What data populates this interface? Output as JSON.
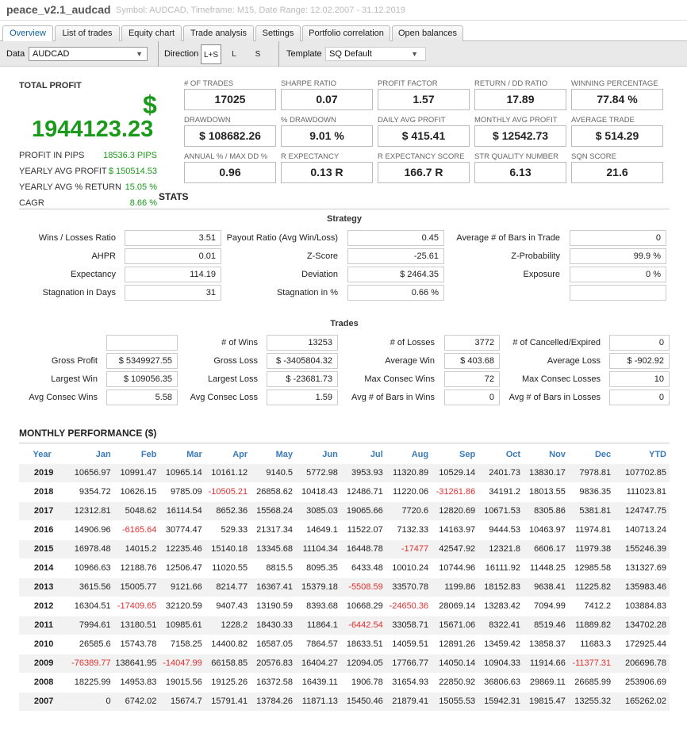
{
  "header": {
    "title": "peace_v2.1_audcad",
    "subtitle": "Symbol: AUDCAD, Timeframe: M15, Date Range: 12.02.2007 - 31.12.2019"
  },
  "tabs": [
    "Overview",
    "List of trades",
    "Equity chart",
    "Trade analysis",
    "Settings",
    "Portfolio correlation",
    "Open balances"
  ],
  "controls": {
    "data_label": "Data",
    "data_value": "AUDCAD",
    "direction_label": "Direction",
    "dir_options": [
      "L+S",
      "L",
      "S"
    ],
    "template_label": "Template",
    "template_value": "SQ Default"
  },
  "summary": {
    "total_profit_label": "TOTAL PROFIT",
    "dollar_sign": "$",
    "total_profit": "1944123.23",
    "rows": [
      [
        "PROFIT IN PIPS",
        "18536.3 PIPS"
      ],
      [
        "YEARLY AVG PROFIT",
        "$ 150514.53"
      ],
      [
        "YEARLY AVG % RETURN",
        "15.05 %"
      ],
      [
        "CAGR",
        "8.66 %"
      ]
    ]
  },
  "metrics": [
    [
      "# OF TRADES",
      "17025"
    ],
    [
      "SHARPE RATIO",
      "0.07"
    ],
    [
      "PROFIT FACTOR",
      "1.57"
    ],
    [
      "RETURN / DD RATIO",
      "17.89"
    ],
    [
      "WINNING PERCENTAGE",
      "77.84 %"
    ],
    [
      "DRAWDOWN",
      "$ 108682.26"
    ],
    [
      "% DRAWDOWN",
      "9.01 %"
    ],
    [
      "DAILY AVG PROFIT",
      "$ 415.41"
    ],
    [
      "MONTHLY AVG PROFIT",
      "$ 12542.73"
    ],
    [
      "AVERAGE TRADE",
      "$ 514.29"
    ],
    [
      "ANNUAL % / MAX DD %",
      "0.96"
    ],
    [
      "R EXPECTANCY",
      "0.13 R"
    ],
    [
      "R EXPECTANCY SCORE",
      "166.7 R"
    ],
    [
      "STR QUALITY NUMBER",
      "6.13"
    ],
    [
      "SQN SCORE",
      "21.6"
    ]
  ],
  "stats_title": "STATS",
  "strategy": {
    "title": "Strategy",
    "rows": [
      [
        [
          "Wins / Losses Ratio",
          "3.51"
        ],
        [
          "Payout Ratio (Avg Win/Loss)",
          "0.45"
        ],
        [
          "Average # of Bars in Trade",
          "0"
        ]
      ],
      [
        [
          "AHPR",
          "0.01"
        ],
        [
          "Z-Score",
          "-25.61"
        ],
        [
          "Z-Probability",
          "99.9 %"
        ]
      ],
      [
        [
          "Expectancy",
          "114.19"
        ],
        [
          "Deviation",
          "$ 2464.35"
        ],
        [
          "Exposure",
          "0 %"
        ]
      ],
      [
        [
          "Stagnation in Days",
          "31"
        ],
        [
          "Stagnation in %",
          "0.66 %"
        ],
        [
          "",
          ""
        ]
      ]
    ]
  },
  "trades": {
    "title": "Trades",
    "rows": [
      [
        [
          "",
          ""
        ],
        [
          "# of Wins",
          "13253"
        ],
        [
          "# of Losses",
          "3772"
        ],
        [
          "# of Cancelled/Expired",
          "0"
        ]
      ],
      [
        [
          "Gross Profit",
          "$ 5349927.55"
        ],
        [
          "Gross Loss",
          "$ -3405804.32"
        ],
        [
          "Average Win",
          "$ 403.68"
        ],
        [
          "Average Loss",
          "$ -902.92"
        ]
      ],
      [
        [
          "Largest Win",
          "$ 109056.35"
        ],
        [
          "Largest Loss",
          "$ -23681.73"
        ],
        [
          "Max Consec Wins",
          "72"
        ],
        [
          "Max Consec Losses",
          "10"
        ]
      ],
      [
        [
          "Avg Consec Wins",
          "5.58"
        ],
        [
          "Avg Consec Loss",
          "1.59"
        ],
        [
          "Avg # of Bars in Wins",
          "0"
        ],
        [
          "Avg # of Bars in Losses",
          "0"
        ]
      ]
    ]
  },
  "monthly": {
    "title": "MONTHLY PERFORMANCE ($)",
    "headers": [
      "Year",
      "Jan",
      "Feb",
      "Mar",
      "Apr",
      "May",
      "Jun",
      "Jul",
      "Aug",
      "Sep",
      "Oct",
      "Nov",
      "Dec",
      "YTD"
    ],
    "rows": [
      [
        "2019",
        "10656.97",
        "10991.47",
        "10965.14",
        "10161.12",
        "9140.5",
        "5772.98",
        "3953.93",
        "11320.89",
        "10529.14",
        "2401.73",
        "13830.17",
        "7978.81",
        "107702.85"
      ],
      [
        "2018",
        "9354.72",
        "10626.15",
        "9785.09",
        "-10505.21",
        "26858.62",
        "10418.43",
        "12486.71",
        "11220.06",
        "-31261.86",
        "34191.2",
        "18013.55",
        "9836.35",
        "111023.81"
      ],
      [
        "2017",
        "12312.81",
        "5048.62",
        "16114.54",
        "8652.36",
        "15568.24",
        "3085.03",
        "19065.66",
        "7720.6",
        "12820.69",
        "10671.53",
        "8305.86",
        "5381.81",
        "124747.75"
      ],
      [
        "2016",
        "14906.96",
        "-6165.64",
        "30774.47",
        "529.33",
        "21317.34",
        "14649.1",
        "11522.07",
        "7132.33",
        "14163.97",
        "9444.53",
        "10463.97",
        "11974.81",
        "140713.24"
      ],
      [
        "2015",
        "16978.48",
        "14015.2",
        "12235.46",
        "15140.18",
        "13345.68",
        "11104.34",
        "16448.78",
        "-17477",
        "42547.92",
        "12321.8",
        "6606.17",
        "11979.38",
        "155246.39"
      ],
      [
        "2014",
        "10966.63",
        "12188.76",
        "12506.47",
        "11020.55",
        "8815.5",
        "8095.35",
        "6433.48",
        "10010.24",
        "10744.96",
        "16111.92",
        "11448.25",
        "12985.58",
        "131327.69"
      ],
      [
        "2013",
        "3615.56",
        "15005.77",
        "9121.66",
        "8214.77",
        "16367.41",
        "15379.18",
        "-5508.59",
        "33570.78",
        "1199.86",
        "18152.83",
        "9638.41",
        "11225.82",
        "135983.46"
      ],
      [
        "2012",
        "16304.51",
        "-17409.65",
        "32120.59",
        "9407.43",
        "13190.59",
        "8393.68",
        "10668.29",
        "-24650.36",
        "28069.14",
        "13283.42",
        "7094.99",
        "7412.2",
        "103884.83"
      ],
      [
        "2011",
        "7994.61",
        "13180.51",
        "10985.61",
        "1228.2",
        "18430.33",
        "11864.1",
        "-6442.54",
        "33058.71",
        "15671.06",
        "8322.41",
        "8519.46",
        "11889.82",
        "134702.28"
      ],
      [
        "2010",
        "26585.6",
        "15743.78",
        "7158.25",
        "14400.82",
        "16587.05",
        "7864.57",
        "18633.51",
        "14059.51",
        "12891.26",
        "13459.42",
        "13858.37",
        "11683.3",
        "172925.44"
      ],
      [
        "2009",
        "-76389.77",
        "138641.95",
        "-14047.99",
        "66158.85",
        "20576.83",
        "16404.27",
        "12094.05",
        "17766.77",
        "14050.14",
        "10904.33",
        "11914.66",
        "-11377.31",
        "206696.78"
      ],
      [
        "2008",
        "18225.99",
        "14953.83",
        "19015.56",
        "19125.26",
        "16372.58",
        "16439.11",
        "1906.78",
        "31654.93",
        "22850.92",
        "36806.63",
        "29869.11",
        "26685.99",
        "253906.69"
      ],
      [
        "2007",
        "0",
        "6742.02",
        "15674.7",
        "15791.41",
        "13784.26",
        "11871.13",
        "15450.46",
        "21879.41",
        "15055.53",
        "15942.31",
        "19815.47",
        "13255.32",
        "165262.02"
      ]
    ]
  }
}
